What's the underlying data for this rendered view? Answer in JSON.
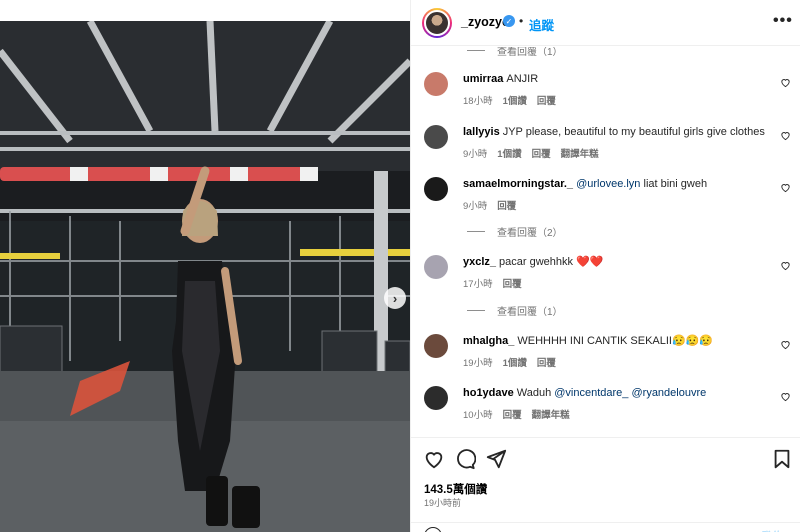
{
  "post": {
    "author": "_zyozyo",
    "follow_label": "追蹤",
    "sep": "•",
    "more_label": "•••",
    "likes": "143.5萬個讚",
    "time": "19小時前",
    "post_label": "發佈",
    "carousel": {
      "slides": 5,
      "active": 0,
      "next_label": "›"
    }
  },
  "comments": {
    "top_replies": "查看回覆（1）",
    "items": [
      {
        "user": "umirraa",
        "text": "ANJIR",
        "time": "18小時",
        "likes": "1個讚",
        "reply": "回覆",
        "translate": "",
        "avatar_color": "#c87a6a"
      },
      {
        "user": "lallyyis",
        "text": "JYP please, beautiful to my beautiful girls give clothes",
        "time": "9小時",
        "likes": "1個讚",
        "reply": "回覆",
        "translate": "翻譯年糕",
        "avatar_color": "#4a4a4a"
      },
      {
        "user": "samaelmorningstar._",
        "mention": "@urlovee.lyn",
        "text": " liat bini gweh",
        "time": "9小時",
        "likes": "",
        "reply": "回覆",
        "translate": "",
        "avatar_color": "#1a1a1a"
      },
      {
        "user": "yxclz_",
        "text": "pacar gwehhkk ❤️❤️",
        "time": "17小時",
        "likes": "",
        "reply": "回覆",
        "translate": "",
        "avatar_color": "#a7a3b0"
      },
      {
        "user": "mhalgha_",
        "text": "WEHHHH INI CANTIK SEKALII😥😥😥",
        "time": "19小時",
        "likes": "1個讚",
        "reply": "回覆",
        "translate": "",
        "avatar_color": "#6b4a3c"
      },
      {
        "user": "ho1ydave",
        "text": "Waduh ",
        "mention": "@vincentdare_",
        "mention2": "@ryandelouvre",
        "time": "10小時",
        "likes": "",
        "reply": "回覆",
        "translate": "翻譯年糕",
        "avatar_color": "#2c2c2c"
      }
    ],
    "replies_2": "查看回覆（2）",
    "replies_1": "查看回覆（1）"
  },
  "icons": [
    "verified-icon",
    "more-icon",
    "heart-icon",
    "comment-icon",
    "share-icon",
    "bookmark-icon",
    "emoji-icon"
  ],
  "colors": {
    "accent": "#0095f6",
    "mention": "#00376b",
    "muted": "#737373"
  }
}
